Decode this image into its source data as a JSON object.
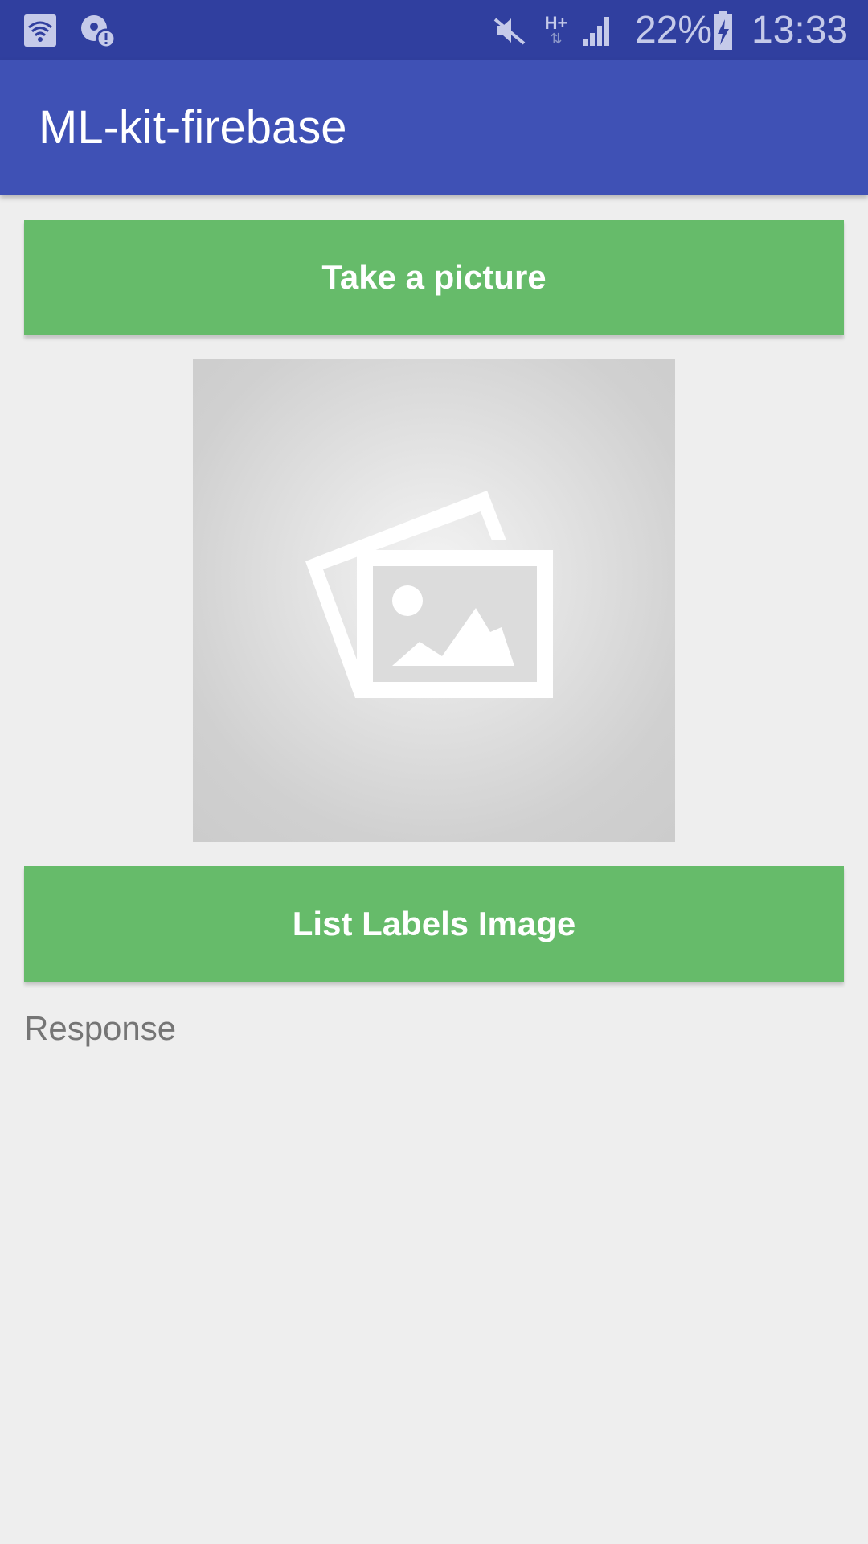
{
  "status_bar": {
    "battery_percent": "22%",
    "time": "13:33",
    "network_type": "H+",
    "icons": [
      "wifi-icon",
      "notification-alert-icon",
      "mute-icon",
      "network-data-icon",
      "signal-icon",
      "battery-charging-icon"
    ]
  },
  "app_bar": {
    "title": "ML-kit-firebase"
  },
  "buttons": {
    "take_picture": "Take a picture",
    "list_labels": "List Labels Image"
  },
  "image_placeholder": {
    "icon": "image-placeholder-icon"
  },
  "response": {
    "text": "Response"
  },
  "colors": {
    "status_bar": "#303f9f",
    "app_bar": "#3f51b5",
    "button": "#66bb6a",
    "background": "#eeeeee"
  }
}
